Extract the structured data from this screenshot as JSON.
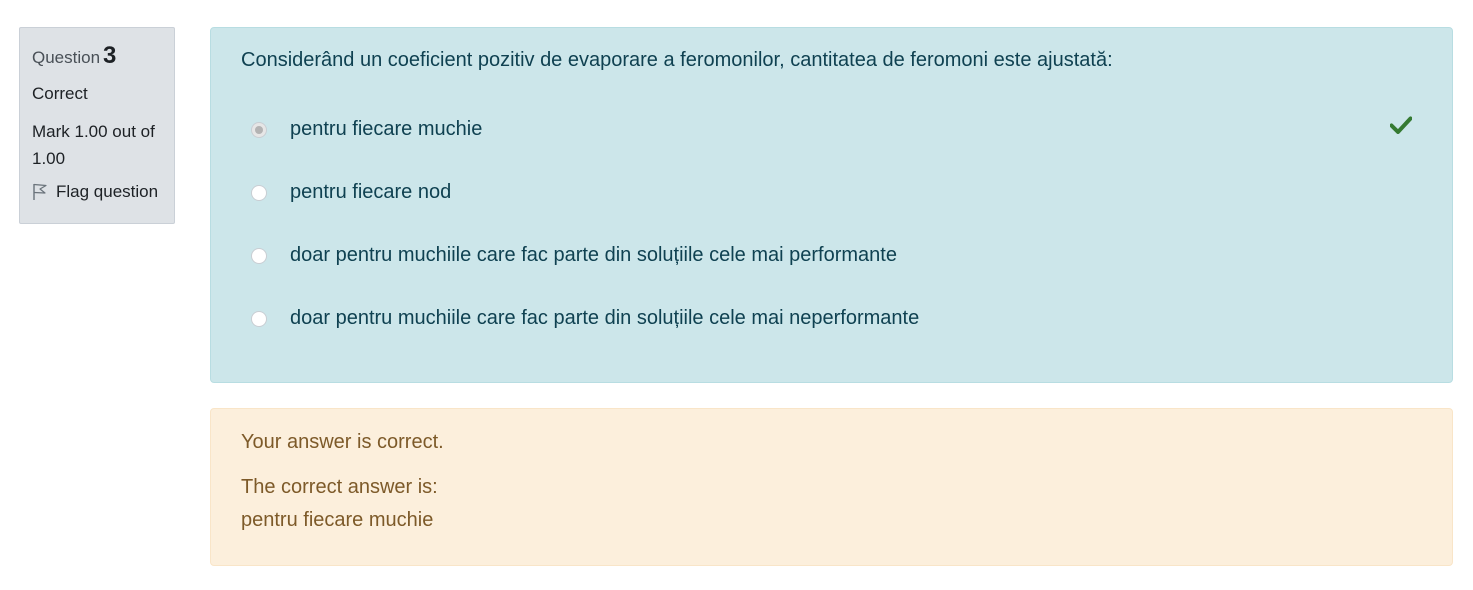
{
  "info": {
    "question_label": "Question",
    "question_number": "3",
    "state": "Correct",
    "grade": "Mark 1.00 out of 1.00",
    "flag_label": "Flag question"
  },
  "question": {
    "text": "Considerând un coeficient pozitiv de evaporare a feromonilor, cantitatea de feromoni este ajustată:",
    "options": [
      {
        "label": "pentru fiecare muchie",
        "selected": true
      },
      {
        "label": "pentru fiecare nod",
        "selected": false
      },
      {
        "label": "doar pentru muchiile care fac parte din soluțiile cele mai performante",
        "selected": false
      },
      {
        "label": "doar pentru muchiile care fac parte din soluțiile cele mai neperformante",
        "selected": false
      }
    ],
    "correct_icon": "check-icon"
  },
  "outcome": {
    "feedback": "Your answer is correct.",
    "right_answer_label": "The correct answer is:",
    "right_answer": "pentru fiecare muchie"
  },
  "colors": {
    "formulation_bg": "#cce6ea",
    "outcome_bg": "#fcefdc",
    "info_bg": "#dee2e6",
    "check_green": "#357a32"
  }
}
